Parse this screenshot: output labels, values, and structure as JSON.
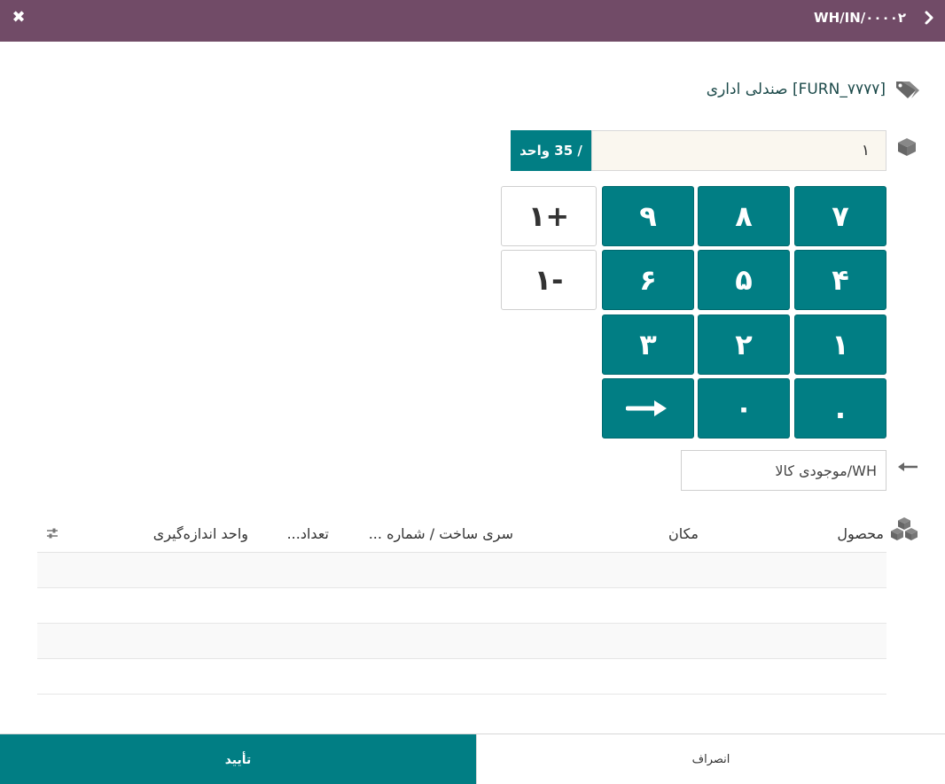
{
  "header": {
    "title": "WH/IN/۰۰۰۰۲",
    "close_icon": "close-icon",
    "back_icon": "chevron-right-icon",
    "bg_color": "#714B67"
  },
  "product": {
    "icon": "tag-icon",
    "label": "[FURN_۷۷۷۷] صندلی اداری"
  },
  "quantity": {
    "icon": "cube-icon",
    "value": "۱",
    "unit_label": "/ 35 واحد"
  },
  "keypad": {
    "rows": [
      [
        "۷",
        "۸",
        "۹"
      ],
      [
        "۴",
        "۵",
        "۶"
      ],
      [
        "۱",
        "۲",
        "۳"
      ],
      [
        ".",
        "۰",
        "⟶"
      ]
    ],
    "plus_one": "۱+",
    "minus_one": "۱-",
    "accent_color": "#017E84"
  },
  "location": {
    "icon": "arrow-left-icon",
    "value": "WH/موجودی کالا"
  },
  "table": {
    "icon": "cubes-icon",
    "columns": {
      "product": "محصول",
      "location": "مکان",
      "lot": "سری ساخت / شماره ...",
      "qty": "تعداد...",
      "uom": "واحد اندازه‌گیری"
    },
    "settings_icon": "sliders-icon",
    "rows": []
  },
  "footer": {
    "confirm": "تأیید",
    "cancel": "انصراف"
  }
}
